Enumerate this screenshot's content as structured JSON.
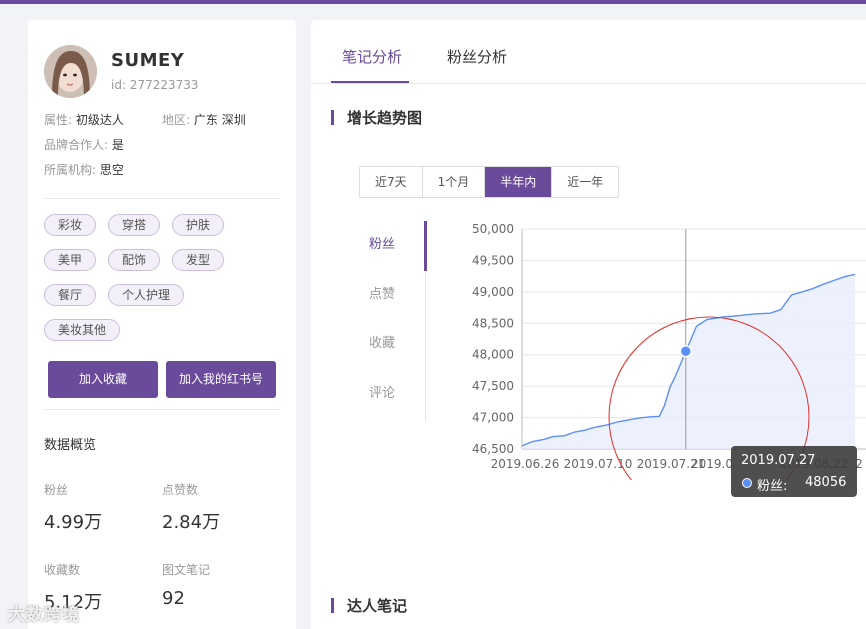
{
  "profile": {
    "nickname": "SUMEY",
    "id": "id: 277223733",
    "attr_label": "属性:",
    "attr_value": "初级达人",
    "region_label": "地区:",
    "region_value": "广东 深圳",
    "brand_label": "品牌合作人:",
    "brand_value": "是",
    "org_label": "所属机构:",
    "org_value": "思空"
  },
  "tags": [
    "彩妆",
    "穿搭",
    "护肤",
    "美甲",
    "配饰",
    "发型",
    "餐厅",
    "个人护理",
    "美妆其他"
  ],
  "buttons": {
    "add_favorite": "加入收藏",
    "add_account": "加入我的红书号"
  },
  "overview": {
    "title": "数据概览",
    "stats": [
      {
        "label": "粉丝",
        "value": "4.99万"
      },
      {
        "label": "点赞数",
        "value": "2.84万"
      },
      {
        "label": "收藏数",
        "value": "5.12万"
      },
      {
        "label": "图文笔记",
        "value": "92"
      }
    ]
  },
  "main": {
    "tabs": [
      {
        "label": "笔记分析",
        "active": true
      },
      {
        "label": "粉丝分析",
        "active": false
      }
    ],
    "growth_title": "增长趋势图",
    "ranges": [
      {
        "label": "近7天",
        "active": false
      },
      {
        "label": "1个月",
        "active": false
      },
      {
        "label": "半年内",
        "active": true
      },
      {
        "label": "近一年",
        "active": false
      }
    ],
    "metrics": [
      {
        "label": "粉丝",
        "active": true
      },
      {
        "label": "点赞",
        "active": false
      },
      {
        "label": "收藏",
        "active": false
      },
      {
        "label": "评论",
        "active": false
      }
    ],
    "notes_title": "达人笔记"
  },
  "tooltip": {
    "date": "2019.07.27",
    "series": "粉丝:",
    "value": "48056"
  },
  "watermark": "大数跨境",
  "colors": {
    "accent": "#6a4a9b",
    "line": "#5b8ff9",
    "area": "#e8eefc",
    "highlight_circle": "#e0302c"
  },
  "chart_data": {
    "type": "area",
    "series": [
      {
        "name": "粉丝"
      }
    ],
    "x_tick_labels": [
      "2019.06.26",
      "2019.07.10",
      "2019.07.21",
      "2019.0",
      "2019.08.22",
      "2"
    ],
    "ylim": [
      46500,
      50000
    ],
    "y_ticks": [
      46500,
      47000,
      47500,
      48000,
      48500,
      49000,
      49500,
      50000
    ],
    "y_tick_labels": [
      "46,500",
      "47,000",
      "47,500",
      "48,000",
      "48,500",
      "49,000",
      "49,500",
      "50,000"
    ],
    "points": [
      [
        "2019.06.26",
        46550
      ],
      [
        "2019.06.28",
        46620
      ],
      [
        "2019.06.30",
        46650
      ],
      [
        "2019.07.02",
        46700
      ],
      [
        "2019.07.04",
        46710
      ],
      [
        "2019.07.06",
        46770
      ],
      [
        "2019.07.08",
        46800
      ],
      [
        "2019.07.10",
        46850
      ],
      [
        "2019.07.12",
        46880
      ],
      [
        "2019.07.14",
        46930
      ],
      [
        "2019.07.16",
        46960
      ],
      [
        "2019.07.18",
        46990
      ],
      [
        "2019.07.20",
        47010
      ],
      [
        "2019.07.22",
        47020
      ],
      [
        "2019.07.23",
        47200
      ],
      [
        "2019.07.24",
        47480
      ],
      [
        "2019.07.25",
        47650
      ],
      [
        "2019.07.26",
        47850
      ],
      [
        "2019.07.27",
        48056
      ],
      [
        "2019.07.28",
        48250
      ],
      [
        "2019.07.29",
        48450
      ],
      [
        "2019.07.31",
        48560
      ],
      [
        "2019.08.03",
        48600
      ],
      [
        "2019.08.06",
        48620
      ],
      [
        "2019.08.09",
        48650
      ],
      [
        "2019.08.12",
        48660
      ],
      [
        "2019.08.14",
        48720
      ],
      [
        "2019.08.16",
        48950
      ],
      [
        "2019.08.18",
        49000
      ],
      [
        "2019.08.20",
        49050
      ],
      [
        "2019.08.22",
        49120
      ],
      [
        "2019.08.24",
        49180
      ],
      [
        "2019.08.26",
        49240
      ],
      [
        "2019.08.28",
        49280
      ]
    ],
    "highlight_point": [
      "2019.07.27",
      48056
    ],
    "grid": true
  }
}
